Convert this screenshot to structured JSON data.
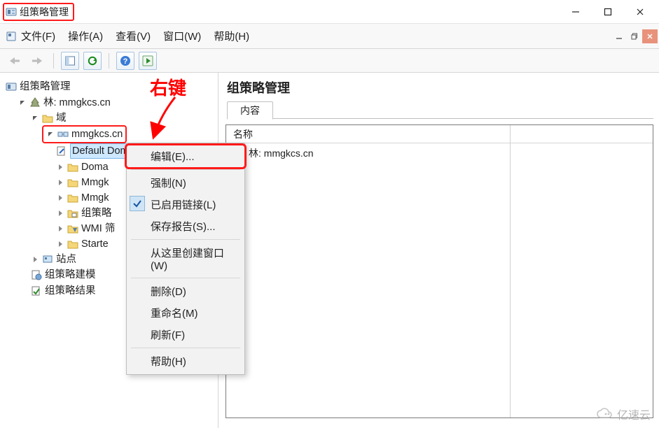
{
  "window": {
    "title": "组策略管理"
  },
  "menu": {
    "file": "文件(F)",
    "action": "操作(A)",
    "view": "查看(V)",
    "window": "窗口(W)",
    "help": "帮助(H)"
  },
  "annotation": {
    "right_click": "右键"
  },
  "tree": {
    "root": "组策略管理",
    "forest": "林: mmgkcs.cn",
    "domains": "域",
    "domain": "mmgkcs.cn",
    "children": {
      "default_policy": "Default Domain Policy",
      "domain_controllers": "Doma",
      "mmgk1": "Mmgk",
      "mmgk2": "Mmgk",
      "gpo": "组策略",
      "wmi": "WMI 筛",
      "starter": "Starte"
    },
    "sites": "站点",
    "modeling": "组策略建模",
    "results": "组策略结果"
  },
  "context_menu": {
    "edit": "编辑(E)...",
    "enforce": "强制(N)",
    "link_enabled": "已启用链接(L)",
    "save_report": "保存报告(S)...",
    "new_window": "从这里创建窗口(W)",
    "delete": "删除(D)",
    "rename": "重命名(M)",
    "refresh": "刷新(F)",
    "help": "帮助(H)"
  },
  "details": {
    "title": "组策略管理",
    "tab": "内容",
    "column_name": "名称",
    "row1": "林: mmgkcs.cn"
  },
  "watermark": "亿速云"
}
